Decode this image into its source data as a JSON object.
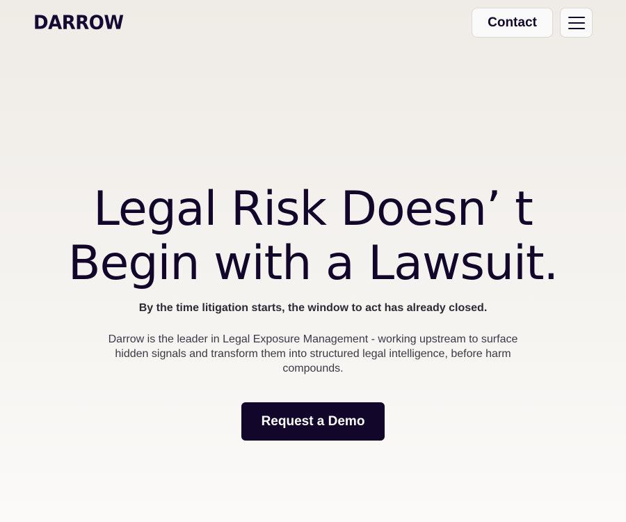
{
  "header": {
    "logo_text": "DARROW",
    "contact_label": "Contact",
    "menu_icon": "hamburger-menu-icon"
  },
  "hero": {
    "headline_line1": "Legal Risk Doesn’ t",
    "headline_line2": "Begin with a Lawsuit.",
    "subheadline": "By the time litigation starts, the window to act has already closed.",
    "description": "Darrow is the leader in Legal Exposure Management - working upstream to surface hidden signals and transform them into structured legal intelligence, before harm compounds.",
    "cta_label": "Request a Demo"
  },
  "colors": {
    "primary": "#12062b",
    "background": "#efebe6",
    "button_text": "#ffffff"
  }
}
